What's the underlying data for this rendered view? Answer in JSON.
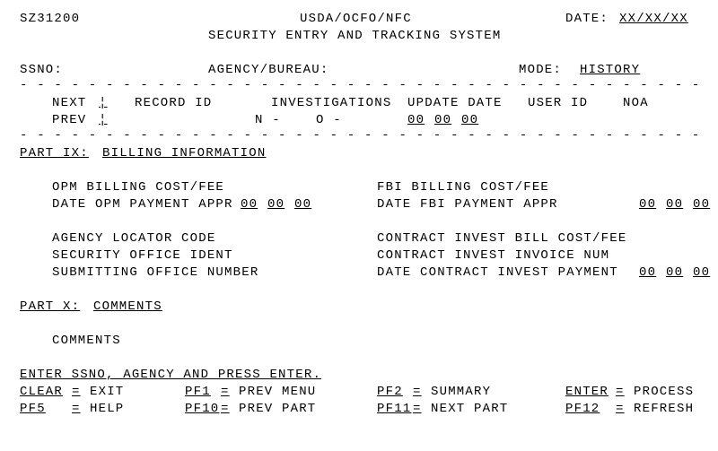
{
  "header": {
    "screen_id": "SZ31200",
    "org": "USDA/OCFO/NFC",
    "date_label": "DATE:",
    "date_value": "XX/XX/XX",
    "system_title": "SECURITY ENTRY AND TRACKING SYSTEM"
  },
  "idline": {
    "ssno_label": "SSNO:",
    "agency_label": "AGENCY/BUREAU:",
    "mode_label": "MODE:",
    "mode_value": "HISTORY"
  },
  "nav": {
    "next_label": "NEXT",
    "prev_label": "PREV",
    "next_value": "¦",
    "prev_value": "¦",
    "record_id_label": "RECORD ID",
    "investigations_label": "INVESTIGATIONS",
    "update_date_label": "UPDATE DATE",
    "user_id_label": "USER ID",
    "noa_label": "NOA",
    "inv_n": "N -",
    "inv_o": "O -",
    "upd_mm": "00",
    "upd_dd": "00",
    "upd_yy": "00"
  },
  "part9": {
    "header": "PART IX: BILLING INFORMATION",
    "header_prefix": "PART ",
    "header_ix": "IX:",
    "header_rest": "BILLING INFORMATION",
    "opm_fee": "OPM BILLING COST/FEE",
    "fbi_fee": "FBI BILLING COST/FEE",
    "opm_date": "DATE OPM PAYMENT APPR",
    "fbi_date": "DATE FBI PAYMENT APPR",
    "opm_mm": "00",
    "opm_dd": "00",
    "opm_yy": "00",
    "fbi_mm": "00",
    "fbi_dd": "00",
    "fbi_yy": "00",
    "agency_loc": "AGENCY LOCATOR CODE",
    "contract_fee": "CONTRACT INVEST BILL COST/FEE",
    "sec_office": "SECURITY OFFICE IDENT",
    "contract_inv": "CONTRACT INVEST INVOICE NUM",
    "submit_office": "SUBMITTING OFFICE NUMBER",
    "contract_date": "DATE CONTRACT INVEST PAYMENT",
    "ci_mm": "00",
    "ci_dd": "00",
    "ci_yy": "00"
  },
  "part10": {
    "header_prefix": "PART ",
    "header_x": "X:",
    "header_rest": "COMMENTS",
    "comments_label": "COMMENTS"
  },
  "footer": {
    "instruction": "ENTER SSNO, AGENCY AND PRESS ENTER.",
    "clear": "CLEAR",
    "clear_v": "EXIT",
    "pf1": "PF1",
    "pf1_v": "PREV MENU",
    "pf2": "PF2",
    "pf2_v": "SUMMARY",
    "enter": "ENTER",
    "enter_v": "PROCESS",
    "pf5": "PF5",
    "pf5_v": "HELP",
    "pf10": "PF10",
    "pf10_v": "PREV PART",
    "pf11": "PF11",
    "pf11_v": "NEXT PART",
    "pf12": "PF12",
    "pf12_v": "REFRESH",
    "eq": "="
  }
}
